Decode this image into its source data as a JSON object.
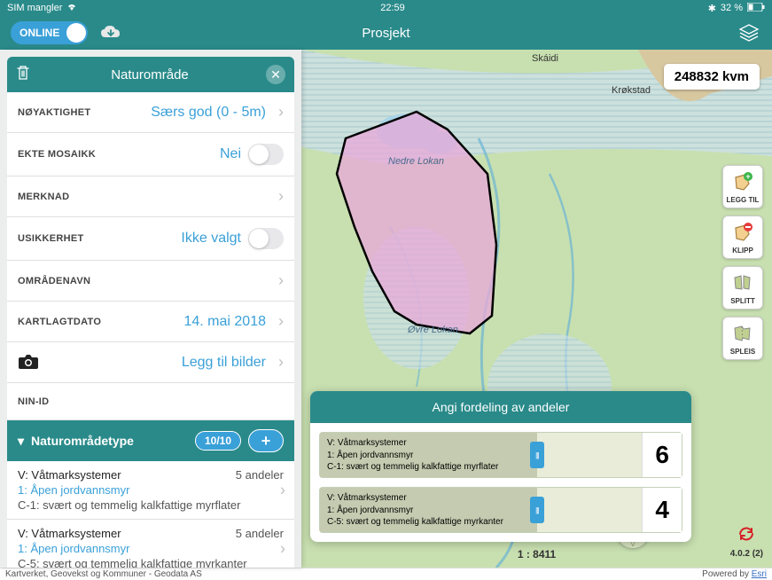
{
  "statusbar": {
    "carrier": "SIM mangler",
    "time": "22:59",
    "battery": "32 %"
  },
  "header": {
    "online_label": "ONLINE",
    "title": "Prosjekt"
  },
  "sidebar": {
    "title": "Naturområde",
    "rows": {
      "accuracy_label": "NØYAKTIGHET",
      "accuracy_value": "Særs god (0 - 5m)",
      "mosaic_label": "EKTE MOSAIKK",
      "mosaic_value": "Nei",
      "note_label": "MERKNAD",
      "uncertainty_label": "USIKKERHET",
      "uncertainty_value": "Ikke valgt",
      "areaname_label": "OMRÅDENAVN",
      "date_label": "KARTLAGTDATO",
      "date_value": "14. mai 2018",
      "photo_label": "Legg til bilder",
      "ninid_label": "NIN-ID"
    },
    "type_section": {
      "title": "Naturområdetype",
      "pill": "10/10"
    },
    "type_items": [
      {
        "line1": "V: Våtmarksystemer",
        "shares": "5 andeler",
        "line2": "1: Åpen jordvannsmyr",
        "line3": "C-1: svært og temmelig kalkfattige myrflater"
      },
      {
        "line1": "V: Våtmarksystemer",
        "shares": "5 andeler",
        "line2": "1: Åpen jordvannsmyr",
        "line3": "C-5: svært og temmelig kalkfattige myrkanter"
      }
    ]
  },
  "map": {
    "area_badge": "248832 kvm",
    "scale": "1 : 8411",
    "labels": {
      "skaidi": "Skáidi",
      "krokstad": "Krøkstad",
      "nedre": "Nedre Lokan",
      "ovre": "Øvre Lokan"
    },
    "tools": {
      "add": "LEGG TIL",
      "clip": "KLIPP",
      "split": "SPLITT",
      "merge": "SPLEIS"
    },
    "version": "4.0.2 (2)"
  },
  "distribution": {
    "title": "Angi fordeling av andeler",
    "items": [
      {
        "l1": "V: Våtmarksystemer",
        "l2": "1: Åpen jordvannsmyr",
        "l3": "C-1: svært og temmelig kalkfattige myrflater",
        "value": "6",
        "pct": 60
      },
      {
        "l1": "V: Våtmarksystemer",
        "l2": "1: Åpen jordvannsmyr",
        "l3": "C-5: svært og temmelig kalkfattige myrkanter",
        "value": "4",
        "pct": 40
      }
    ]
  },
  "footer": {
    "attribution": "Kartverket, Geovekst og Kommuner - Geodata AS",
    "powered": "Powered by ",
    "esri": "Esri"
  }
}
